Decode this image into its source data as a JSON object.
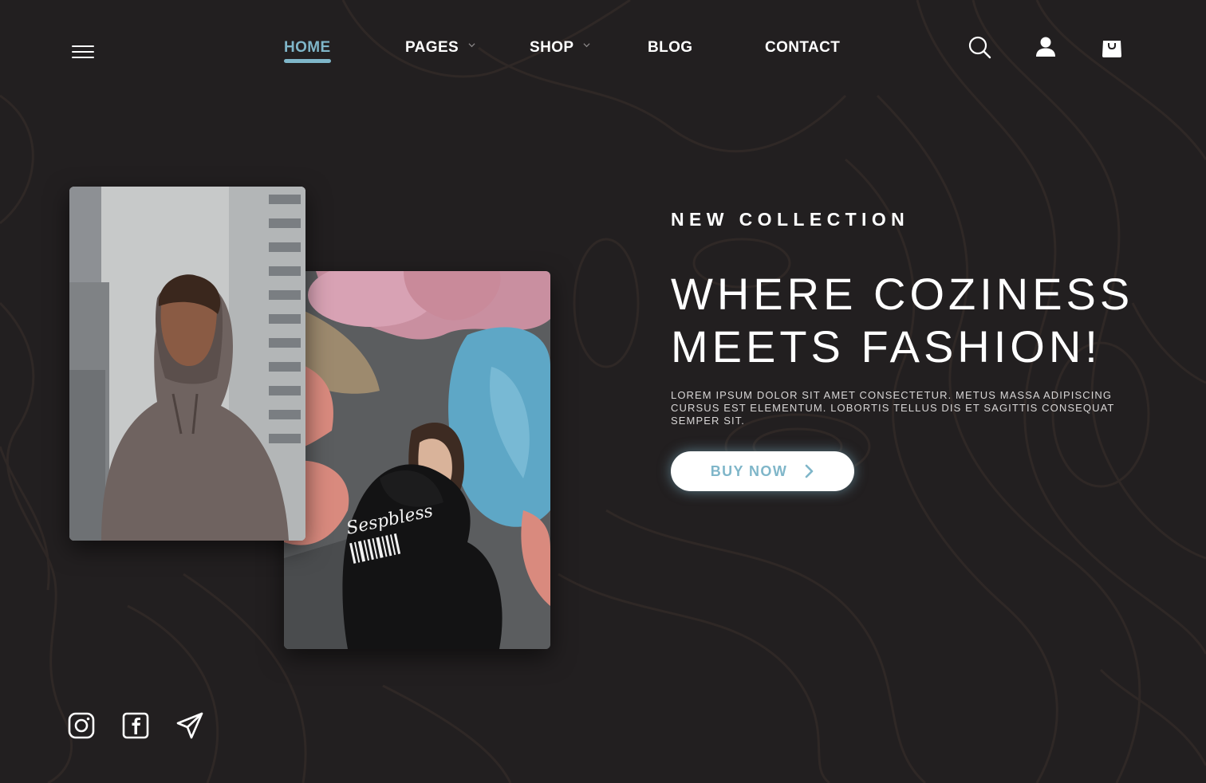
{
  "nav": {
    "items": [
      {
        "label": "HOME",
        "active": true,
        "dropdown": false
      },
      {
        "label": "PAGES",
        "active": false,
        "dropdown": true
      },
      {
        "label": "SHOP",
        "active": false,
        "dropdown": true
      },
      {
        "label": "BLOG",
        "active": false,
        "dropdown": false
      },
      {
        "label": "CONTACT",
        "active": false,
        "dropdown": false
      }
    ]
  },
  "header_icons": [
    "search-icon",
    "user-icon",
    "shopping-bag-icon"
  ],
  "hero": {
    "eyebrow": "NEW COLLECTION",
    "headline_line1": "WHERE COZINESS",
    "headline_line2": "MEETS FASHION!",
    "body": "LOREM IPSUM DOLOR SIT AMET CONSECTETUR. METUS MASSA ADIPISCING CURSUS EST ELEMENTUM. LOBORTIS TELLUS DIS ET SAGITTIS CONSEQUAT SEMPER SIT.",
    "button_label": "BUY NOW"
  },
  "social_icons": [
    "instagram-icon",
    "facebook-icon",
    "send-icon"
  ],
  "colors": {
    "background": "#221f20",
    "accent": "#7fb6c9",
    "text": "#ffffff"
  }
}
